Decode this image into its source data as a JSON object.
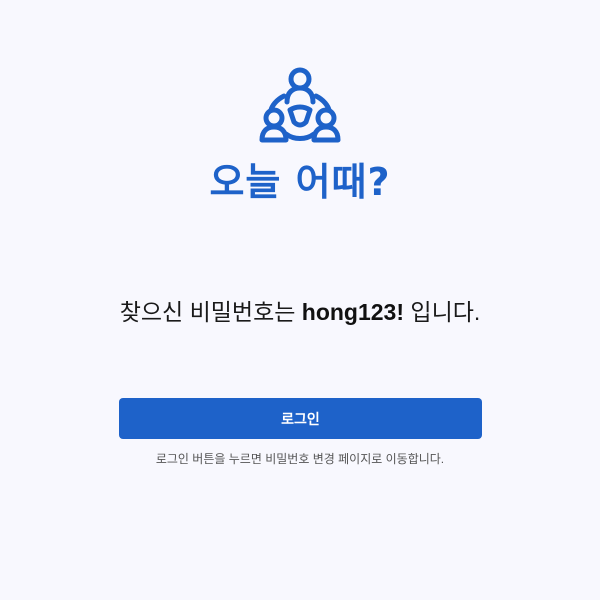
{
  "brand": {
    "logo_icon": "people-circle-icon",
    "name": "오늘 어때?",
    "color": "#1e62c9"
  },
  "message": {
    "prefix": "찾으신 비밀번호는 ",
    "password": "hong123!",
    "suffix": " 입니다."
  },
  "login_button": {
    "label": "로그인",
    "color": "#1e62c9"
  },
  "hint": "로그인 버튼을 누르면 비밀번호 변경 페이지로 이동합니다."
}
